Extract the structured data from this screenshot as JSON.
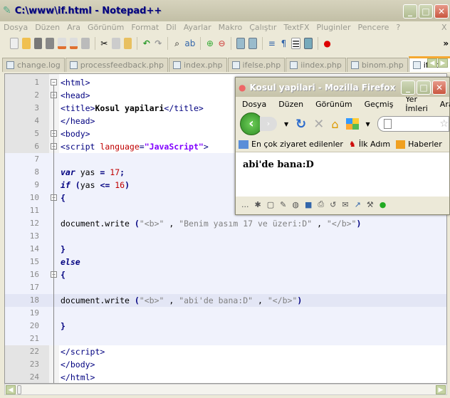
{
  "window": {
    "title": "C:\\www\\if.html - Notepad++"
  },
  "menu": [
    "Dosya",
    "Düzen",
    "Ara",
    "Görünüm",
    "Format",
    "Dil",
    "Ayarlar",
    "Makro",
    "Çalıştır",
    "TextFX",
    "Pluginler",
    "Pencere",
    "?"
  ],
  "menu_close": "X",
  "tabs": [
    {
      "label": "change.log"
    },
    {
      "label": "processfeedback.php"
    },
    {
      "label": "index.php"
    },
    {
      "label": "ifelse.php"
    },
    {
      "label": "iindex.php"
    },
    {
      "label": "binom.php"
    },
    {
      "label": "if.html",
      "active": true
    }
  ],
  "code": [
    [
      [
        "t",
        "<html>"
      ]
    ],
    [
      [
        "t",
        "<head>"
      ]
    ],
    [
      [
        "t",
        "<title>"
      ],
      [
        "b",
        "Kosul yapilari"
      ],
      [
        "t",
        "</title>"
      ]
    ],
    [
      [
        "t",
        "</head>"
      ]
    ],
    [
      [
        "t",
        "<body>"
      ]
    ],
    [
      [
        "t",
        "<script "
      ],
      [
        "a",
        "language"
      ],
      [
        "t",
        "="
      ],
      [
        "v",
        "\"JavaScript\""
      ],
      [
        "t",
        ">"
      ]
    ],
    [],
    [
      [
        "k",
        "var"
      ],
      [
        "p",
        " yas "
      ],
      [
        "o",
        "="
      ],
      [
        "p",
        " "
      ],
      [
        "n",
        "17"
      ],
      [
        "o",
        ";"
      ]
    ],
    [
      [
        "k",
        "if"
      ],
      [
        "p",
        " "
      ],
      [
        "o",
        "("
      ],
      [
        "p",
        "yas "
      ],
      [
        "o",
        "<="
      ],
      [
        "p",
        " "
      ],
      [
        "n",
        "16"
      ],
      [
        "o",
        ")"
      ]
    ],
    [
      [
        "o",
        "{"
      ]
    ],
    [],
    [
      [
        "p",
        "document.write "
      ],
      [
        "o",
        "("
      ],
      [
        "s",
        "\"<b>\""
      ],
      [
        "p",
        " , "
      ],
      [
        "s",
        "\"Benim yasım 17 ve üzeri:D\""
      ],
      [
        "p",
        " , "
      ],
      [
        "s",
        "\"</b>\""
      ],
      [
        "o",
        ")"
      ]
    ],
    [],
    [
      [
        "o",
        "}"
      ]
    ],
    [
      [
        "k",
        "else"
      ]
    ],
    [
      [
        "o",
        "{"
      ]
    ],
    [],
    [
      [
        "p",
        "document.write "
      ],
      [
        "o",
        "("
      ],
      [
        "s",
        "\"<b>\""
      ],
      [
        "p",
        " , "
      ],
      [
        "s",
        "\"abi'de bana:D\""
      ],
      [
        "p",
        " , "
      ],
      [
        "s",
        "\"</b>\""
      ],
      [
        "o",
        ")"
      ]
    ],
    [],
    [
      [
        "o",
        "}"
      ]
    ],
    [],
    [
      [
        "t",
        "</script>"
      ]
    ],
    [
      [
        "t",
        "</body>"
      ]
    ],
    [
      [
        "t",
        "</html>"
      ]
    ]
  ],
  "firefox": {
    "title": "Kosul yapilari - Mozilla Firefox",
    "menu": [
      "Dosya",
      "Düzen",
      "Görünüm",
      "Geçmiş",
      "Yer İmleri",
      "Araçla"
    ],
    "bookmarks": [
      "En çok ziyaret edilenler",
      "İlk Adım",
      "Haberler"
    ],
    "content": "abi'de bana:D",
    "status_dots": "..."
  }
}
